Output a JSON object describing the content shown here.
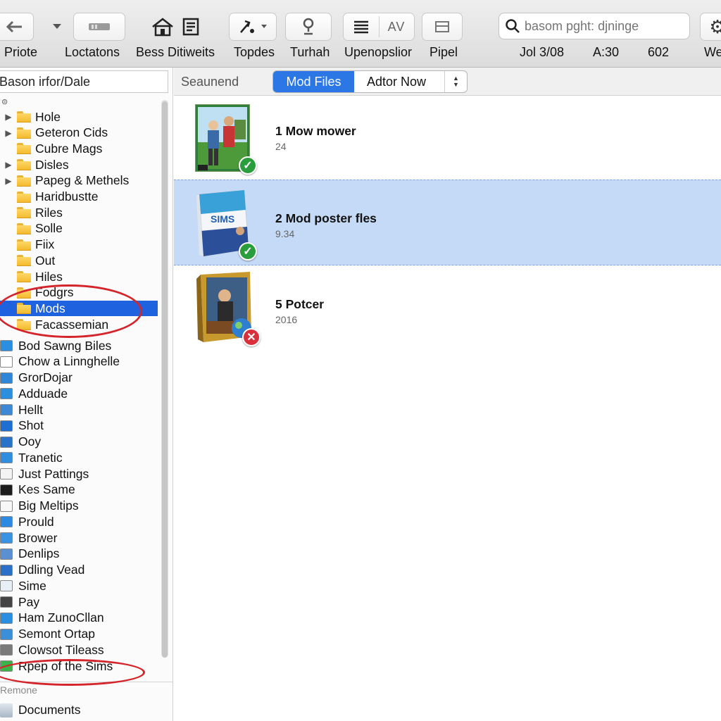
{
  "toolbar": {
    "labels": [
      "Priote",
      "Loctatons",
      "Bess Ditiweits",
      "Topdes",
      "Turhah",
      "Upenopslior",
      "Pipel"
    ],
    "view_segment_right": "AV",
    "search_placeholder": "basom pght: djninge",
    "status": [
      "Jol 3/08",
      "A:30",
      "602",
      "We"
    ]
  },
  "sidebar": {
    "search_value": "Bason irfor/Dale",
    "folders": [
      {
        "label": "Hole",
        "expandable": true
      },
      {
        "label": "Geteron Cids",
        "expandable": true
      },
      {
        "label": "Cubre Mags",
        "expandable": false
      },
      {
        "label": "Disles",
        "expandable": true
      },
      {
        "label": "Papeg & Methels",
        "expandable": true
      },
      {
        "label": "Haridbustte",
        "expandable": false
      },
      {
        "label": "Riles",
        "expandable": false
      },
      {
        "label": "Solle",
        "expandable": false
      },
      {
        "label": "Fiix",
        "expandable": false
      },
      {
        "label": "Out",
        "expandable": false
      },
      {
        "label": "Hiles",
        "expandable": false
      },
      {
        "label": "Fodgrs",
        "expandable": false
      },
      {
        "label": "Mods",
        "expandable": false,
        "selected": true
      },
      {
        "label": "Facassemian",
        "expandable": false
      }
    ],
    "apps": [
      {
        "label": "Bod Sawng Biles",
        "icon": "folder-blue-icon",
        "color": "#2a8fe0"
      },
      {
        "label": "Chow a Linnghelle",
        "icon": "blank-app-icon",
        "color": "#ffffff"
      },
      {
        "label": "GrorDojar",
        "icon": "puzzle-icon",
        "color": "#2f86d9"
      },
      {
        "label": "Adduade",
        "icon": "folder-blue-icon",
        "color": "#2b8ede"
      },
      {
        "label": "Hellt",
        "icon": "window-icon",
        "color": "#3d89d6"
      },
      {
        "label": "Shot",
        "icon": "camera-icon",
        "color": "#1f6ed1"
      },
      {
        "label": "Ooy",
        "icon": "disc-icon",
        "color": "#2a73c9"
      },
      {
        "label": "Tranetic",
        "icon": "folder-blue-icon",
        "color": "#2f8ee0"
      },
      {
        "label": "Just Pattings",
        "icon": "blank-app-icon",
        "color": "#f4f4f4"
      },
      {
        "label": "Kes Same",
        "icon": "terminal-icon",
        "color": "#1c1c1c"
      },
      {
        "label": "Big Meltips",
        "icon": "blank-app-icon",
        "color": "#f7f7f7"
      },
      {
        "label": "Prould",
        "icon": "folder-blue-icon",
        "color": "#2c8be0"
      },
      {
        "label": "Brower",
        "icon": "folder-blue-icon",
        "color": "#3a92e2"
      },
      {
        "label": "Denlips",
        "icon": "compass-icon",
        "color": "#5a8fd1"
      },
      {
        "label": "Ddling Vead",
        "icon": "drop-icon",
        "color": "#2a6fc8"
      },
      {
        "label": "Sime",
        "icon": "blank-app-icon",
        "color": "#e8eef5"
      },
      {
        "label": "Pay",
        "icon": "eye-icon",
        "color": "#444444"
      },
      {
        "label": "Ham ZunoCllan",
        "icon": "folder-blue-icon",
        "color": "#2a8fe0"
      },
      {
        "label": "Semont Ortap",
        "icon": "folder-blue-icon",
        "color": "#3a8fd8"
      },
      {
        "label": "Clowsot Tileass",
        "icon": "gear-app-icon",
        "color": "#7a7a7a"
      },
      {
        "label": "Rpep of the Sims",
        "icon": "sims-icon",
        "color": "#3cb34a"
      }
    ],
    "section_label": "Remone",
    "documents_label": "Documents"
  },
  "main": {
    "breadcrumb": "Seaunend",
    "segment": {
      "active": "Mod Files",
      "inactive": "Adtor Now"
    },
    "items": [
      {
        "title": "1 Mow mower",
        "subtitle": "24",
        "status": "ok",
        "selected": false
      },
      {
        "title": "2 Mod poster fles",
        "subtitle": "9.34",
        "status": "ok",
        "selected": true,
        "box_text": "SIMS"
      },
      {
        "title": "5 Potcer",
        "subtitle": "2016",
        "status": "error",
        "selected": false
      }
    ]
  },
  "colors": {
    "selection": "#1f62e0",
    "item_selected": "#c4daf7",
    "annotation": "#d4252c",
    "segment_active": "#2b77e6"
  }
}
